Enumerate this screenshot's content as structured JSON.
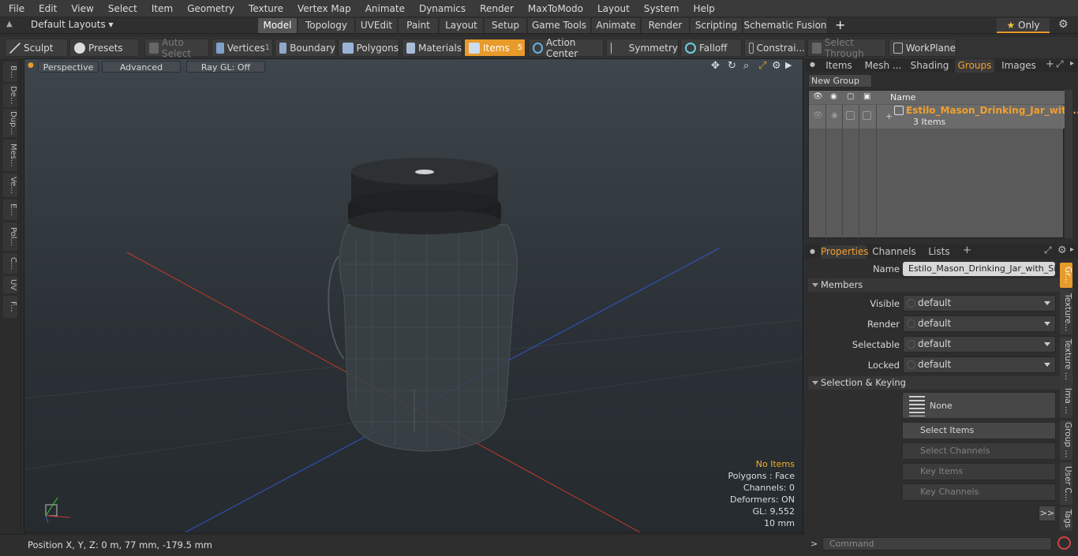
{
  "menubar": [
    "File",
    "Edit",
    "View",
    "Select",
    "Item",
    "Geometry",
    "Texture",
    "Vertex Map",
    "Animate",
    "Dynamics",
    "Render",
    "MaxToModo",
    "Layout",
    "System",
    "Help"
  ],
  "layouts": {
    "selector": "Default Layouts",
    "tabs": [
      "Model",
      "Topology",
      "UVEdit",
      "Paint",
      "Layout",
      "Setup",
      "Game Tools",
      "Animate",
      "Render",
      "Scripting",
      "Schematic Fusion"
    ],
    "active": "Model",
    "add": "+",
    "only": "Only"
  },
  "toolbar": {
    "sculpt": "Sculpt",
    "presets": "Presets",
    "auto_select": "Auto Select",
    "vertices": "Vertices",
    "vertices_count": "1",
    "boundary": "Boundary",
    "polygons": "Polygons",
    "materials": "Materials",
    "items": "Items",
    "items_count": "5",
    "action_center": "Action Center",
    "symmetry": "Symmetry",
    "falloff": "Falloff",
    "constraints": "Constrai...",
    "select_through": "Select Through",
    "workplane": "WorkPlane"
  },
  "left_tabs": [
    "B...",
    "De...",
    "Dup...",
    "Mes...",
    "Ve...",
    "E...",
    "Pol...",
    "C...",
    "UV",
    "F..."
  ],
  "viewport": {
    "perspective": "Perspective",
    "advanced": "Advanced",
    "raygl": "Ray GL: Off",
    "info": {
      "no_items": "No Items",
      "polygons": "Polygons : Face",
      "channels": "Channels: 0",
      "deformers": "Deformers: ON",
      "gl": "GL: 9,552",
      "scale": "10 mm"
    }
  },
  "status": {
    "position": "Position X, Y, Z:   0 m, 77 mm, -179.5 mm"
  },
  "groups_panel": {
    "tabs": [
      "Items",
      "Mesh ...",
      "Shading",
      "Groups",
      "Images"
    ],
    "active": "Groups",
    "new_group": "New Group",
    "col_name": "Name",
    "row": {
      "name": "Estilo_Mason_Drinking_Jar_wit ...",
      "sub": "3 Items"
    }
  },
  "properties": {
    "tabs": [
      "Properties",
      "Channels",
      "Lists"
    ],
    "active": "Properties",
    "name_label": "Name",
    "name_value": "Estilo_Mason_Drinking_Jar_with_Sip_l",
    "members": "Members",
    "rows": [
      {
        "label": "Visible",
        "value": "default"
      },
      {
        "label": "Render",
        "value": "default"
      },
      {
        "label": "Selectable",
        "value": "default"
      },
      {
        "label": "Locked",
        "value": "default"
      }
    ],
    "selection_keying": "Selection & Keying",
    "none": "None",
    "select_items": "Select Items",
    "select_channels": "Select Channels",
    "key_items": "Key Items",
    "key_channels": "Key Channels",
    "more": ">>",
    "side_tabs": [
      "Gr...",
      "Texture...",
      "Texture ...",
      "Ima ...",
      "Group ...",
      "User C...",
      "Tags"
    ]
  },
  "command": {
    "placeholder": "Command",
    "prompt": ">"
  },
  "colors": {
    "accent": "#e89a2a",
    "x_axis": "#c0392b",
    "z_axis": "#3355cc",
    "active_tab": "#f0a030"
  }
}
